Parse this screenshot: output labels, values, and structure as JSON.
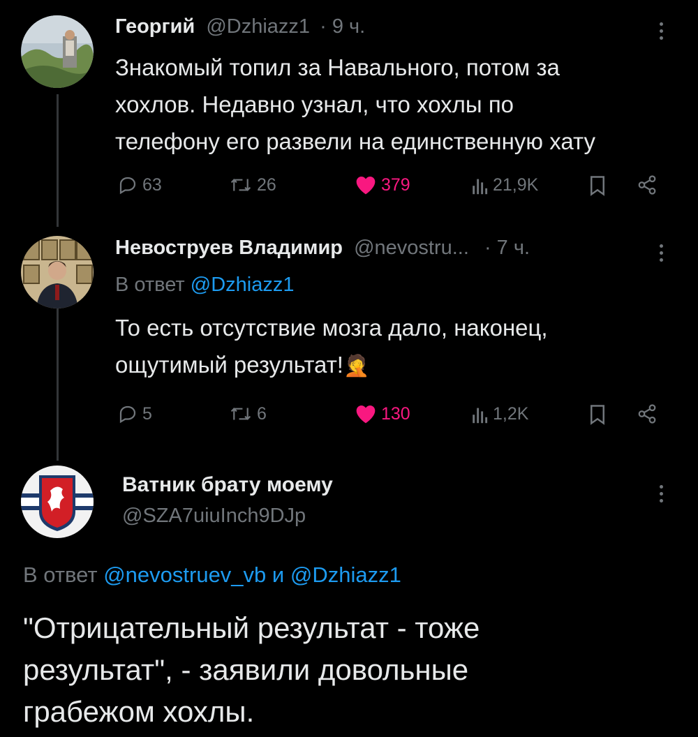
{
  "tweets": [
    {
      "author": "Георгий",
      "handle": "@Dzhiazz1",
      "time": "· 9 ч.",
      "text_lines": [
        "Знакомый топил за Навального, потом за",
        "хохлов. Недавно узнал, что хохлы по",
        "телефону его развели на единственную хату"
      ],
      "replies": "63",
      "retweets": "26",
      "likes": "379",
      "views": "21,9K"
    },
    {
      "author": "Невоструев Владимир",
      "handle": "@nevostru...",
      "time": "· 7 ч.",
      "reply_prefix": "В ответ",
      "reply_to": "@Dzhiazz1",
      "text_lines": [
        "То есть отсутствие мозга дало, наконец,",
        "ощутимый результат!"
      ],
      "emoji": "🤦",
      "replies": "5",
      "retweets": "6",
      "likes": "130",
      "views": "1,2K"
    },
    {
      "author": "Ватник брату моему",
      "handle": "@SZA7uiuInch9DJp",
      "reply_prefix": "В ответ",
      "reply_to_1": "@nevostruev_vb",
      "reply_and": "и",
      "reply_to_2": "@Dzhiazz1",
      "text_lines": [
        "\"Отрицательный результат - тоже",
        "результат\", - заявили довольные",
        "грабежом хохлы."
      ]
    }
  ],
  "colors": {
    "background": "#000000",
    "text": "#e7e9ea",
    "muted": "#71767b",
    "link": "#1d9bf0",
    "like": "#f91880",
    "thread_line": "#333639"
  },
  "icons": [
    "reply-icon",
    "retweet-icon",
    "heart-icon",
    "views-icon",
    "bookmark-icon",
    "share-icon",
    "more-icon"
  ]
}
